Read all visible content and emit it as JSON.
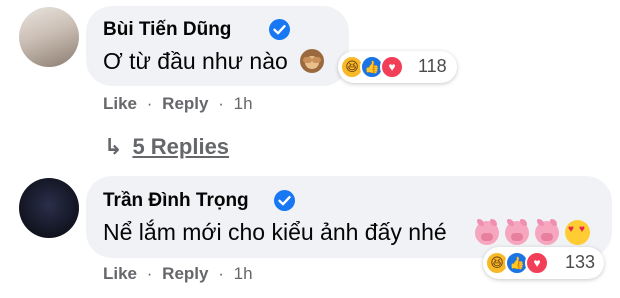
{
  "comments": [
    {
      "author": "Bùi Tiến Dũng",
      "verified": true,
      "text": "Ơ từ đầu như nào",
      "reaction_count": "118",
      "like_label": "Like",
      "reply_label": "Reply",
      "separator": "·",
      "time": "1h",
      "emoji": [
        "see-no-evil-monkey"
      ]
    },
    {
      "author": "Trần Đình Trọng",
      "verified": true,
      "text": "Nể lắm mới cho kiểu ảnh đấy nhé",
      "reaction_count": "133",
      "like_label": "Like",
      "reply_label": "Reply",
      "separator": "·",
      "time": "1h",
      "emoji": [
        "pig-face",
        "pig-face",
        "pig-face",
        "smiling-face-with-hearts"
      ]
    }
  ],
  "replies": {
    "arrow": "↳",
    "label": "5 Replies"
  },
  "reaction_types": [
    "haha",
    "like",
    "love"
  ],
  "colors": {
    "bubble": "#f0f2f5",
    "verified": "#1877f2",
    "meta_text": "#65676b",
    "like": "#1b74e4",
    "love": "#f33e58",
    "haha": "#f7b928"
  }
}
